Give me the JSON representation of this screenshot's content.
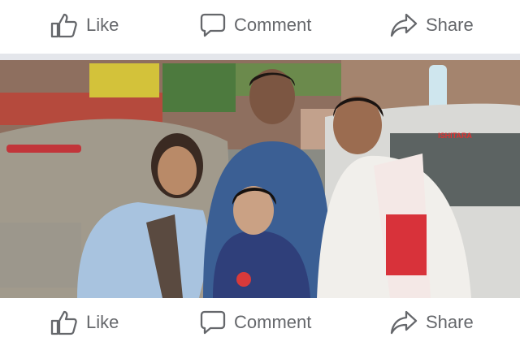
{
  "post_actions_top": {
    "like_label": "Like",
    "comment_label": "Comment",
    "share_label": "Share"
  },
  "post_actions_bottom": {
    "like_label": "Like",
    "comment_label": "Comment",
    "share_label": "Share"
  },
  "photo": {
    "plate_text": "ISHITARA"
  },
  "colors": {
    "action_gray": "#65676b",
    "divider": "#e4e6eb",
    "gamosa_red": "#d8323a"
  }
}
